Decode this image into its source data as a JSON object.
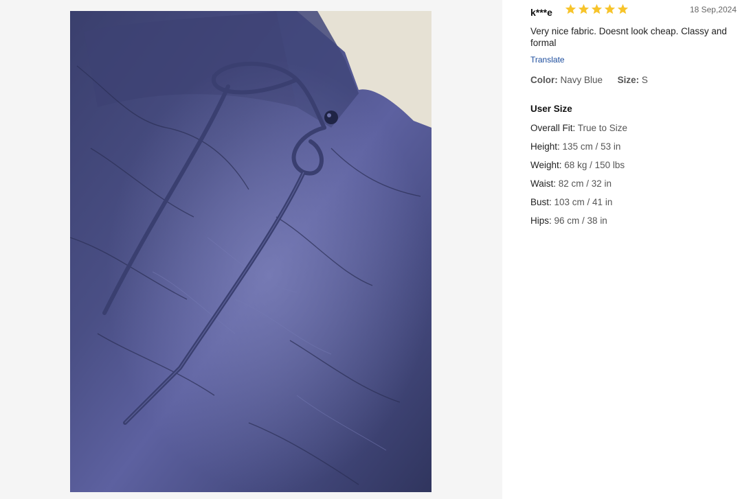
{
  "review": {
    "reviewer": "k***e",
    "rating": 5,
    "rating_max": 5,
    "star_color": "#f7c42b",
    "date": "18 Sep,2024",
    "text": "Very nice fabric. Doesnt look cheap. Classy and formal",
    "translate_label": "Translate",
    "color_label": "Color:",
    "color_value": "Navy Blue",
    "size_label": "Size:",
    "size_value": "S"
  },
  "user_size": {
    "title": "User Size",
    "rows": [
      {
        "label": "Overall Fit:",
        "value": "True to Size"
      },
      {
        "label": "Height:",
        "value": "135 cm / 53 in"
      },
      {
        "label": "Weight:",
        "value": "68 kg / 150 lbs"
      },
      {
        "label": "Waist:",
        "value": "82 cm / 32 in"
      },
      {
        "label": "Bust:",
        "value": "103 cm / 41 in"
      },
      {
        "label": "Hips:",
        "value": "96 cm / 38 in"
      }
    ]
  },
  "photo": {
    "icon": "review-photo",
    "fabric_color": "#3c4170",
    "background_color": "#e8e4da"
  }
}
